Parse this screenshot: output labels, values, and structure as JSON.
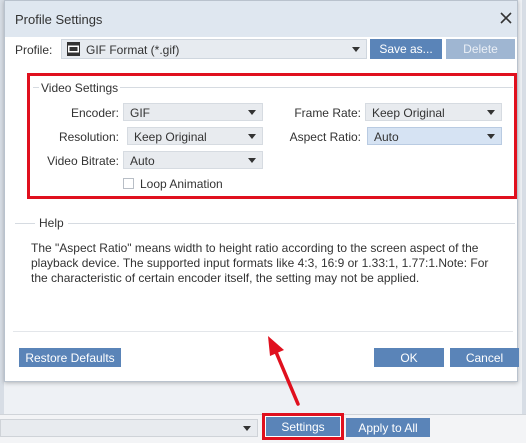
{
  "dialog": {
    "title": "Profile Settings",
    "profile_label": "Profile:",
    "profile_value": "GIF Format (*.gif)",
    "save_as_label": "Save as...",
    "delete_label": "Delete"
  },
  "video_settings": {
    "legend": "Video Settings",
    "encoder_label": "Encoder:",
    "encoder_value": "GIF",
    "resolution_label": "Resolution:",
    "resolution_value": "Keep Original",
    "video_bitrate_label": "Video Bitrate:",
    "video_bitrate_value": "Auto",
    "frame_rate_label": "Frame Rate:",
    "frame_rate_value": "Keep Original",
    "aspect_ratio_label": "Aspect Ratio:",
    "aspect_ratio_value": "Auto",
    "loop_animation_label": "Loop Animation",
    "loop_animation_checked": false
  },
  "help": {
    "legend": "Help",
    "text": "The \"Aspect Ratio\" means width to height ratio according to the screen aspect of the playback device. The supported input formats like 4:3, 16:9 or 1.33:1, 1.77:1.Note: For the characteristic of certain encoder itself, the setting may not be applied."
  },
  "footer": {
    "restore_defaults_label": "Restore Defaults",
    "ok_label": "OK",
    "cancel_label": "Cancel"
  },
  "background_app": {
    "settings_label": "Settings",
    "apply_to_all_label": "Apply to All"
  },
  "colors": {
    "accent_button": "#5a84b8",
    "disabled_button": "#9fb6d2",
    "highlight_frame": "#e0101e",
    "titlebar": "#dfe7f0"
  },
  "icons": [
    "close-icon",
    "gif-file-icon",
    "chevron-down-icon",
    "annotation-arrow"
  ]
}
